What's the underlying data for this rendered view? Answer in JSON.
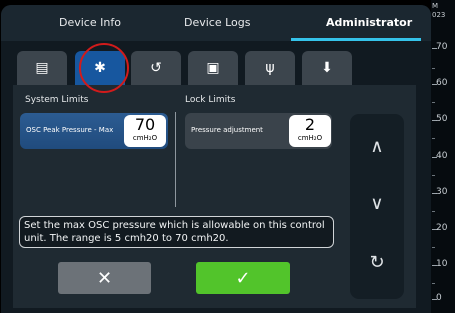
{
  "header": {
    "tabs": [
      "Device Info",
      "Device Logs",
      "Administrator"
    ],
    "active_tab": "Administrator"
  },
  "icon_tabs": [
    {
      "name": "list-icon",
      "glyph": "▤"
    },
    {
      "name": "gear-icon",
      "glyph": "✱"
    },
    {
      "name": "restore-icon",
      "glyph": "↺"
    },
    {
      "name": "save-icon",
      "glyph": "▣"
    },
    {
      "name": "usb-icon",
      "glyph": "ψ"
    },
    {
      "name": "download-icon",
      "glyph": "⬇"
    }
  ],
  "active_icon_tab": 1,
  "sections": {
    "system_limits": "System Limits",
    "lock_limits": "Lock Limits"
  },
  "params": {
    "system": {
      "label": "OSC Peak Pressure - Max",
      "value": "70",
      "unit": "cmH₂O"
    },
    "lock": {
      "label": "Pressure adjustment",
      "value": "2",
      "unit": "cmH₂O"
    }
  },
  "nav": {
    "up": "∧",
    "down": "∨",
    "reset": "↻"
  },
  "info_text": "Set the max OSC pressure which is allowable on this control unit. The range is 5 cmh20 to 70 cmh20.",
  "buttons": {
    "cancel": "✕",
    "confirm": "✓"
  },
  "right_scale": {
    "corner": [
      "M",
      "023"
    ],
    "labels": [
      "70",
      "60",
      "50",
      "40",
      "30",
      "20",
      "10",
      "0"
    ]
  },
  "collapse_arrow": "◀",
  "colors": {
    "accent": "#35c3ea",
    "active_tab": "#17579f",
    "highlight": "#d11b1b",
    "confirm": "#52c42b",
    "cancel": "#6c7278"
  }
}
